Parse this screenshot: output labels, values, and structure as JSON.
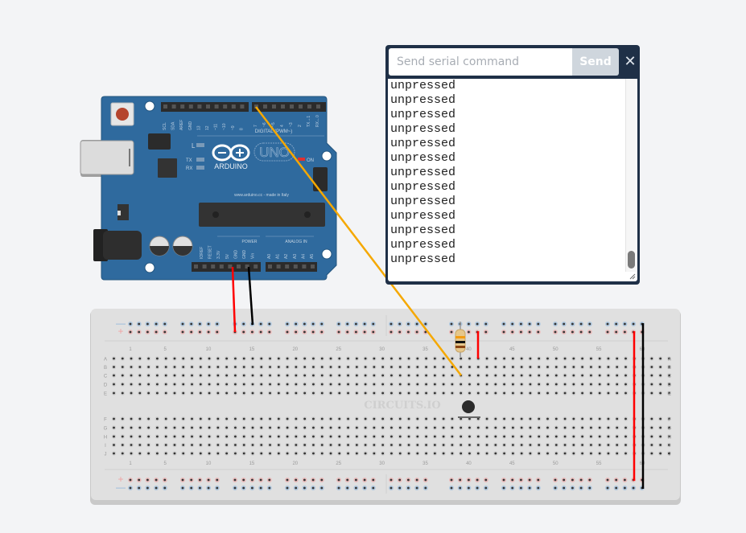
{
  "serial_monitor": {
    "input_placeholder": "Send serial command",
    "input_value": "",
    "send_label": "Send",
    "close_label": "✕",
    "output_lines": [
      "unpressed",
      "unpressed",
      "unpressed",
      "unpressed",
      "unpressed",
      "unpressed",
      "unpressed",
      "unpressed",
      "unpressed",
      "unpressed",
      "unpressed",
      "unpressed",
      "unpressed"
    ],
    "scroll_position": 0.95
  },
  "arduino": {
    "logo_text": "ARDUINO",
    "model_text": "UNO",
    "tx_label": "TX",
    "rx_label": "RX",
    "l_label": "L",
    "on_label": "ON",
    "digital_header": "DIGITAL (PWM~)",
    "power_header": "POWER",
    "analog_header": "ANALOG IN",
    "made_in": "www.arduino.cc - made in Italy",
    "digital_pins_left": [
      "SCL",
      "SDA",
      "AREF",
      "GND",
      "13",
      "12",
      "~11",
      "~10",
      "~9",
      "8"
    ],
    "digital_pins_right": [
      "7",
      "~6",
      "~5",
      "4",
      "~3",
      "2",
      "TX→1",
      "RX←0"
    ],
    "power_pins": [
      "IOREF",
      "RESET",
      "3.3V",
      "5V",
      "GND",
      "GND",
      "Vin"
    ],
    "analog_pins": [
      "A0",
      "A1",
      "A2",
      "A3",
      "A4",
      "A5"
    ],
    "colors": {
      "board": "#2f6a9e",
      "board_dark": "#23557f",
      "header": "#2b2b2b"
    }
  },
  "breadboard": {
    "watermark": "CIRCUITS.IO",
    "row_labels_top": [
      "A",
      "B",
      "C",
      "D",
      "E"
    ],
    "row_labels_bottom": [
      "F",
      "G",
      "H",
      "I",
      "J"
    ],
    "column_numbers": [
      "1",
      "5",
      "10",
      "15",
      "20",
      "25",
      "30",
      "35",
      "40",
      "45",
      "50",
      "55",
      "60"
    ],
    "rail_minus": "—",
    "rail_plus": "+",
    "colors": {
      "board": "#dedede",
      "hole": "#333333",
      "minus": "#8fb7dd",
      "plus": "#f0a3a3"
    }
  },
  "components": {
    "resistor": {
      "name": "resistor",
      "bands": [
        "#f39c12",
        "#111111",
        "#8b4513"
      ]
    },
    "pushbutton": {
      "name": "pushbutton"
    },
    "wires": [
      {
        "name": "wire-5v",
        "color": "#ff0000"
      },
      {
        "name": "wire-gnd",
        "color": "#000000"
      },
      {
        "name": "wire-signal",
        "color": "#f5a800"
      },
      {
        "name": "wire-jumper-red",
        "color": "#ff0000"
      },
      {
        "name": "wire-rail-red",
        "color": "#ff0000"
      },
      {
        "name": "wire-rail-black",
        "color": "#000000"
      }
    ]
  }
}
